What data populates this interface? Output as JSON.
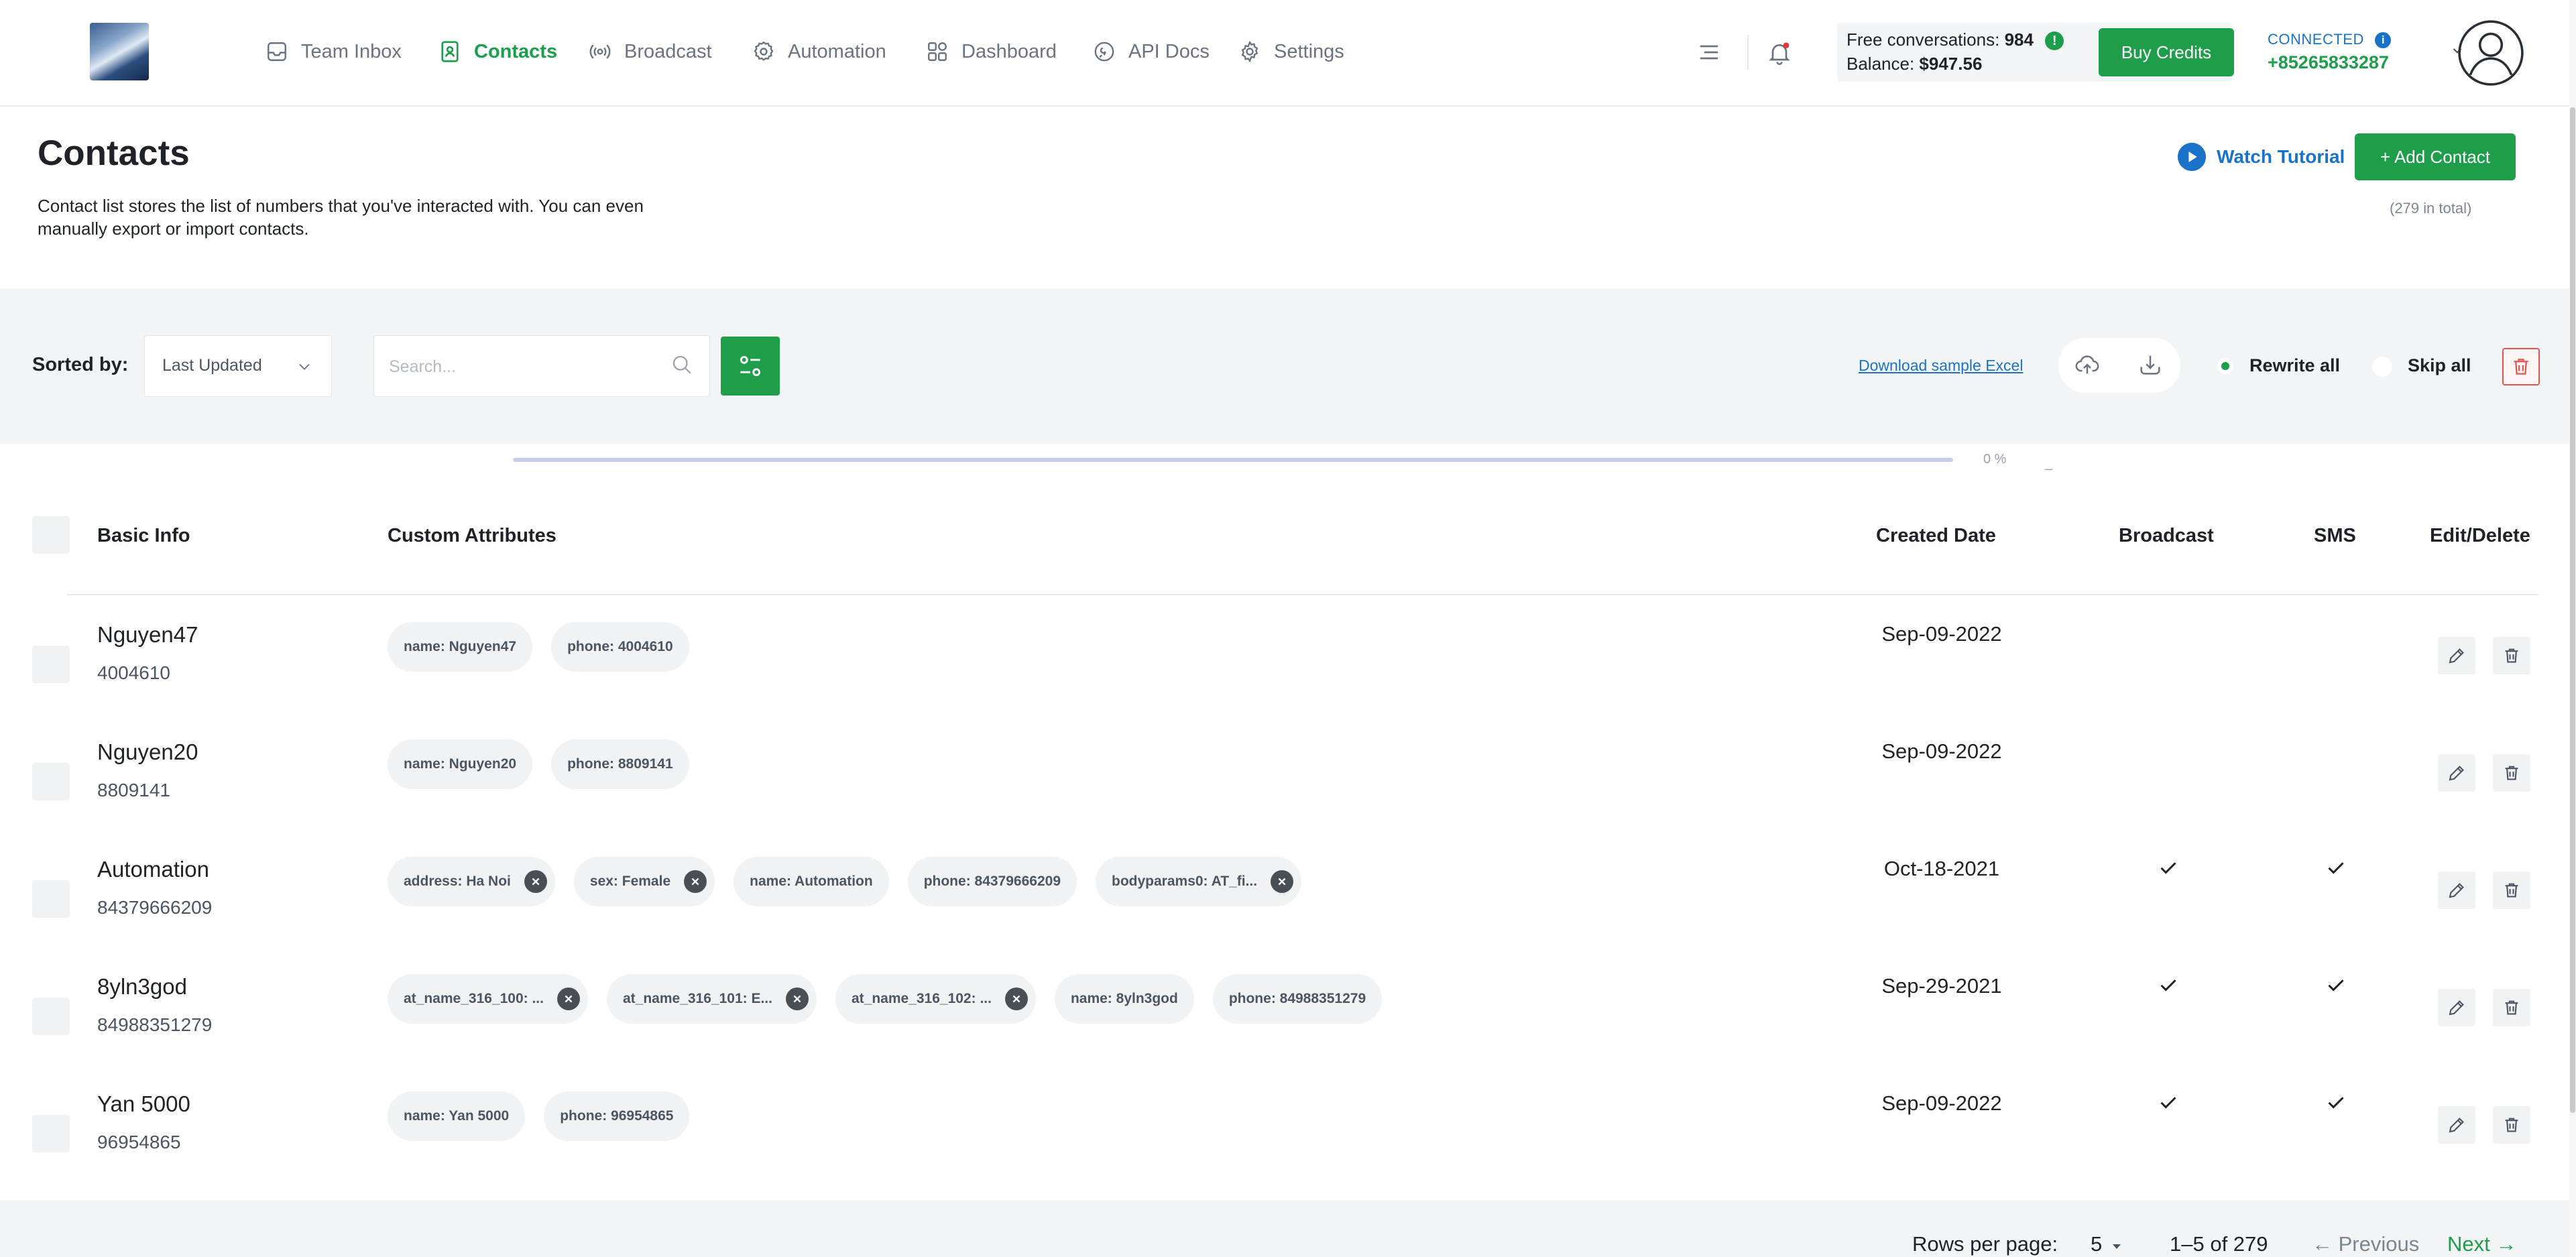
{
  "nav": {
    "items": [
      {
        "label": "Team Inbox",
        "icon": "inbox-icon"
      },
      {
        "label": "Contacts",
        "icon": "contacts-icon",
        "active": true
      },
      {
        "label": "Broadcast",
        "icon": "broadcast-icon"
      },
      {
        "label": "Automation",
        "icon": "automation-gear-icon"
      },
      {
        "label": "Dashboard",
        "icon": "dashboard-grid-icon"
      },
      {
        "label": "API Docs",
        "icon": "api-docs-icon"
      },
      {
        "label": "Settings",
        "icon": "settings-gear-icon"
      }
    ]
  },
  "account": {
    "free_label": "Free conversations:",
    "free_value": "984",
    "free_badge": "!",
    "balance_label": "Balance:",
    "balance_value": "$947.56",
    "buy_credits": "Buy Credits",
    "status": "CONNECTED",
    "status_badge": "i",
    "phone": "+85265833287"
  },
  "header": {
    "title": "Contacts",
    "description": "Contact list stores the list of numbers that you've interacted with. You can even manually export or import contacts.",
    "watch_tutorial": "Watch Tutorial",
    "add_contact": "+ Add Contact",
    "total": "(279 in total)"
  },
  "toolbar": {
    "sort_label": "Sorted by:",
    "sort_value": "Last Updated",
    "search_placeholder": "Search...",
    "download_sample": "Download sample Excel",
    "rewrite_all": "Rewrite all",
    "skip_all": "Skip all"
  },
  "progress": {
    "percent_label": "0 %",
    "fraction": 0,
    "trailing": "_"
  },
  "table": {
    "columns": {
      "basic": "Basic Info",
      "custom": "Custom Attributes",
      "created": "Created Date",
      "broadcast": "Broadcast",
      "sms": "SMS",
      "edit_delete": "Edit/Delete"
    },
    "rows": [
      {
        "name": "Nguyen47",
        "number": "4004610",
        "attributes": [
          {
            "text": "name: Nguyen47",
            "removable": false
          },
          {
            "text": "phone: 4004610",
            "removable": false
          }
        ],
        "created": "Sep-09-2022",
        "broadcast": false,
        "sms": false
      },
      {
        "name": "Nguyen20",
        "number": "8809141",
        "attributes": [
          {
            "text": "name: Nguyen20",
            "removable": false
          },
          {
            "text": "phone: 8809141",
            "removable": false
          }
        ],
        "created": "Sep-09-2022",
        "broadcast": false,
        "sms": false
      },
      {
        "name": "Automation",
        "number": "84379666209",
        "attributes": [
          {
            "text": "address: Ha Noi",
            "removable": true
          },
          {
            "text": "sex: Female",
            "removable": true
          },
          {
            "text": "name: Automation",
            "removable": false
          },
          {
            "text": "phone: 84379666209",
            "removable": false
          },
          {
            "text": "bodyparams0: AT_fi...",
            "removable": true
          }
        ],
        "created": "Oct-18-2021",
        "broadcast": true,
        "sms": true
      },
      {
        "name": "8yln3god",
        "number": "84988351279",
        "attributes": [
          {
            "text": "at_name_316_100: ...",
            "removable": true
          },
          {
            "text": "at_name_316_101: E...",
            "removable": true
          },
          {
            "text": "at_name_316_102: ...",
            "removable": true
          },
          {
            "text": "name: 8yln3god",
            "removable": false
          },
          {
            "text": "phone: 84988351279",
            "removable": false
          }
        ],
        "created": "Sep-29-2021",
        "broadcast": true,
        "sms": true
      },
      {
        "name": "Yan 5000",
        "number": "96954865",
        "attributes": [
          {
            "text": "name: Yan 5000",
            "removable": false
          },
          {
            "text": "phone: 96954865",
            "removable": false
          }
        ],
        "created": "Sep-09-2022",
        "broadcast": true,
        "sms": true
      }
    ]
  },
  "pagination": {
    "rows_per_page_label": "Rows per page:",
    "rows_per_page": "5",
    "range": "1–5 of 279",
    "previous": "← Previous",
    "next": "Next →"
  },
  "colors": {
    "accent": "#1e9e4b",
    "link": "#1a73c8",
    "danger": "#e25555",
    "progress": "#6a74d6"
  }
}
